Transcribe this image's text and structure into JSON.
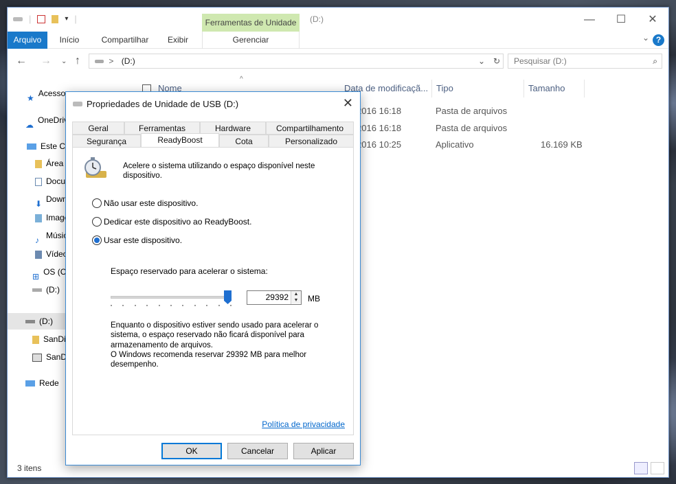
{
  "explorer": {
    "window_title": "(D:)",
    "context_tab": "Ferramentas de Unidade",
    "ribbon_tabs": [
      "Arquivo",
      "Início",
      "Compartilhar",
      "Exibir",
      "Gerenciar"
    ],
    "address": "(D:)",
    "address_sep": ">",
    "search_placeholder": "Pesquisar  (D:)",
    "columns": [
      "Nome",
      "Data de modificaçã...",
      "Tipo",
      "Tamanho"
    ],
    "rows": [
      {
        "date": "06/2016 16:18",
        "type": "Pasta de arquivos",
        "size": ""
      },
      {
        "date": "06/2016 16:18",
        "type": "Pasta de arquivos",
        "size": ""
      },
      {
        "date": "05/2016 10:25",
        "type": "Aplicativo",
        "size": "16.169 KB"
      }
    ],
    "sidebar": [
      {
        "label": "Acesso rápido",
        "icon": "star-icon"
      },
      {
        "label": "OneDrive",
        "icon": "cloud-icon"
      },
      {
        "label": "Este Computador",
        "icon": "computer-icon"
      },
      {
        "label": "Área de Trabalho",
        "icon": "folder-icon"
      },
      {
        "label": "Documentos",
        "icon": "document-icon"
      },
      {
        "label": "Downloads",
        "icon": "download-icon"
      },
      {
        "label": "Imagens",
        "icon": "image-icon"
      },
      {
        "label": "Músicas",
        "icon": "music-icon"
      },
      {
        "label": "Vídeos",
        "icon": "video-icon"
      },
      {
        "label": "OS (C:)",
        "icon": "disk-icon"
      },
      {
        "label": "(D:)",
        "icon": "usb-icon"
      },
      {
        "label": "(D:)",
        "icon": "usb-icon"
      },
      {
        "label": "SanDisk",
        "icon": "folder-icon"
      },
      {
        "label": "SanDisk",
        "icon": "app-icon"
      },
      {
        "label": "Rede",
        "icon": "network-icon"
      }
    ],
    "status": "3 itens"
  },
  "dialog": {
    "title": "Propriedades de Unidade de USB (D:)",
    "tabs_row1": [
      "Geral",
      "Ferramentas",
      "Hardware",
      "Compartilhamento"
    ],
    "tabs_row2": [
      "Segurança",
      "ReadyBoost",
      "Cota",
      "Personalizado"
    ],
    "active_tab": "ReadyBoost",
    "intro": "Acelere o sistema utilizando o espaço disponível neste dispositivo.",
    "options": [
      {
        "label": "Não usar este dispositivo.",
        "checked": false
      },
      {
        "label": "Dedicar este dispositivo ao ReadyBoost.",
        "checked": false
      },
      {
        "label": "Usar este dispositivo.",
        "checked": true
      }
    ],
    "reserved_label": "Espaço reservado para acelerar o sistema:",
    "slider_level": 1.0,
    "reserved_value": "29392",
    "unit": "MB",
    "note_lines": [
      "Enquanto o dispositivo estiver sendo usado para acelerar o",
      "sistema, o espaço reservado não ficará disponível para",
      "armazenamento de arquivos.",
      "O Windows recomenda reservar 29392 MB para melhor",
      "desempenho."
    ],
    "privacy_link": "Política de privacidade",
    "buttons": {
      "ok": "OK",
      "cancel": "Cancelar",
      "apply": "Aplicar"
    }
  },
  "colors": {
    "accent": "#1979ca",
    "context_tab": "#cfe8b0",
    "link": "#0066cc"
  }
}
